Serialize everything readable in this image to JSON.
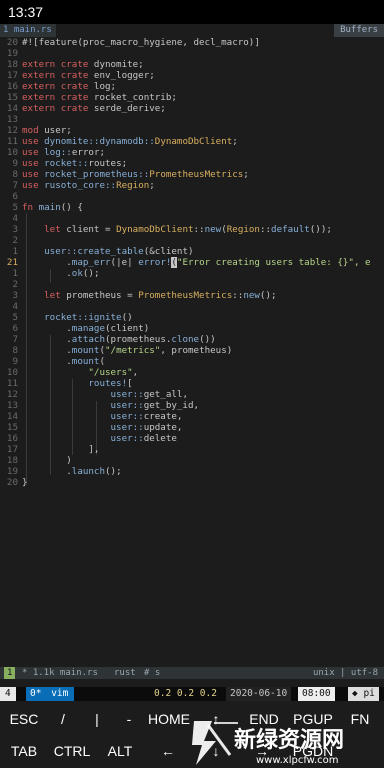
{
  "android_status": {
    "time": "13:37"
  },
  "tabline": {
    "active_tab": "1 main.rs",
    "buffers_label": "Buffers"
  },
  "editor": {
    "lines": [
      {
        "num": "20",
        "tokens": [
          {
            "t": "#![feature(proc_macro_hygiene, decl_macro)]",
            "c": "pl"
          }
        ]
      },
      {
        "num": "19",
        "tokens": []
      },
      {
        "num": "18",
        "tokens": [
          {
            "t": "extern crate",
            "c": "kw"
          },
          {
            "t": " dynomite;",
            "c": "pl"
          }
        ]
      },
      {
        "num": "17",
        "tokens": [
          {
            "t": "extern crate",
            "c": "kw"
          },
          {
            "t": " env_logger;",
            "c": "pl"
          }
        ]
      },
      {
        "num": "16",
        "tokens": [
          {
            "t": "extern crate",
            "c": "kw"
          },
          {
            "t": " log;",
            "c": "pl"
          }
        ]
      },
      {
        "num": "15",
        "tokens": [
          {
            "t": "extern crate",
            "c": "kw"
          },
          {
            "t": " rocket_contrib;",
            "c": "pl"
          }
        ]
      },
      {
        "num": "14",
        "tokens": [
          {
            "t": "extern crate",
            "c": "kw"
          },
          {
            "t": " serde_derive;",
            "c": "pl"
          }
        ]
      },
      {
        "num": "13",
        "tokens": []
      },
      {
        "num": "12",
        "tokens": [
          {
            "t": "mod",
            "c": "kw"
          },
          {
            "t": " user;",
            "c": "pl"
          }
        ]
      },
      {
        "num": "11",
        "tokens": [
          {
            "t": "use",
            "c": "kw"
          },
          {
            "t": " dynomite::dynamodb::",
            "c": "fn"
          },
          {
            "t": "DynamoDbClient",
            "c": "ty"
          },
          {
            "t": ";",
            "c": "pl"
          }
        ]
      },
      {
        "num": "10",
        "tokens": [
          {
            "t": "use",
            "c": "kw"
          },
          {
            "t": " log::",
            "c": "fn"
          },
          {
            "t": "error;",
            "c": "pl"
          }
        ]
      },
      {
        "num": "9",
        "tokens": [
          {
            "t": "use",
            "c": "kw"
          },
          {
            "t": " rocket::",
            "c": "fn"
          },
          {
            "t": "routes;",
            "c": "pl"
          }
        ]
      },
      {
        "num": "8",
        "tokens": [
          {
            "t": "use",
            "c": "kw"
          },
          {
            "t": " rocket_prometheus::",
            "c": "fn"
          },
          {
            "t": "PrometheusMetrics",
            "c": "ty"
          },
          {
            "t": ";",
            "c": "pl"
          }
        ]
      },
      {
        "num": "7",
        "tokens": [
          {
            "t": "use",
            "c": "kw"
          },
          {
            "t": " rusoto_core::",
            "c": "fn"
          },
          {
            "t": "Region",
            "c": "ty"
          },
          {
            "t": ";",
            "c": "pl"
          }
        ]
      },
      {
        "num": "6",
        "tokens": []
      },
      {
        "num": "5",
        "tokens": [
          {
            "t": "fn",
            "c": "kw"
          },
          {
            "t": " main",
            "c": "fn"
          },
          {
            "t": "() {",
            "c": "pl"
          }
        ]
      },
      {
        "num": "4",
        "tokens": []
      },
      {
        "num": "3",
        "tokens": [
          {
            "t": "    let",
            "c": "kw"
          },
          {
            "t": " client = ",
            "c": "pl"
          },
          {
            "t": "DynamoDbClient",
            "c": "ty"
          },
          {
            "t": "::",
            "c": "pl"
          },
          {
            "t": "new",
            "c": "fn"
          },
          {
            "t": "(",
            "c": "pl"
          },
          {
            "t": "Region",
            "c": "ty"
          },
          {
            "t": "::",
            "c": "pl"
          },
          {
            "t": "default",
            "c": "fn"
          },
          {
            "t": "());",
            "c": "pl"
          }
        ]
      },
      {
        "num": "2",
        "tokens": []
      },
      {
        "num": "1",
        "tokens": [
          {
            "t": "    user::",
            "c": "fn"
          },
          {
            "t": "create_table",
            "c": "fn"
          },
          {
            "t": "(&client)",
            "c": "pl"
          }
        ]
      },
      {
        "num": "21",
        "current": true,
        "tokens": [
          {
            "t": "        .",
            "c": "pl"
          },
          {
            "t": "map_err",
            "c": "fn"
          },
          {
            "t": "(|e| ",
            "c": "pl"
          },
          {
            "t": "error!",
            "c": "mac"
          },
          {
            "t": "(",
            "c": "cursor"
          },
          {
            "t": "\"Error creating users table: {}\", e",
            "c": "st"
          }
        ]
      },
      {
        "num": "1",
        "tokens": [
          {
            "t": "        .",
            "c": "pl"
          },
          {
            "t": "ok",
            "c": "fn"
          },
          {
            "t": "();",
            "c": "pl"
          }
        ]
      },
      {
        "num": "2",
        "tokens": []
      },
      {
        "num": "3",
        "tokens": [
          {
            "t": "    let",
            "c": "kw"
          },
          {
            "t": " prometheus = ",
            "c": "pl"
          },
          {
            "t": "PrometheusMetrics",
            "c": "ty"
          },
          {
            "t": "::",
            "c": "pl"
          },
          {
            "t": "new",
            "c": "fn"
          },
          {
            "t": "();",
            "c": "pl"
          }
        ]
      },
      {
        "num": "4",
        "tokens": []
      },
      {
        "num": "5",
        "tokens": [
          {
            "t": "    rocket::",
            "c": "fn"
          },
          {
            "t": "ignite",
            "c": "fn"
          },
          {
            "t": "()",
            "c": "pl"
          }
        ]
      },
      {
        "num": "6",
        "tokens": [
          {
            "t": "        .",
            "c": "pl"
          },
          {
            "t": "manage",
            "c": "fn"
          },
          {
            "t": "(client)",
            "c": "pl"
          }
        ]
      },
      {
        "num": "7",
        "tokens": [
          {
            "t": "        .",
            "c": "pl"
          },
          {
            "t": "attach",
            "c": "fn"
          },
          {
            "t": "(prometheus.",
            "c": "pl"
          },
          {
            "t": "clone",
            "c": "fn"
          },
          {
            "t": "())",
            "c": "pl"
          }
        ]
      },
      {
        "num": "8",
        "tokens": [
          {
            "t": "        .",
            "c": "pl"
          },
          {
            "t": "mount",
            "c": "fn"
          },
          {
            "t": "(",
            "c": "pl"
          },
          {
            "t": "\"/metrics\"",
            "c": "st"
          },
          {
            "t": ", prometheus)",
            "c": "pl"
          }
        ]
      },
      {
        "num": "9",
        "tokens": [
          {
            "t": "        .",
            "c": "pl"
          },
          {
            "t": "mount",
            "c": "fn"
          },
          {
            "t": "(",
            "c": "pl"
          }
        ]
      },
      {
        "num": "10",
        "tokens": [
          {
            "t": "            \"/users\"",
            "c": "st"
          },
          {
            "t": ",",
            "c": "pl"
          }
        ]
      },
      {
        "num": "11",
        "tokens": [
          {
            "t": "            routes!",
            "c": "mac"
          },
          {
            "t": "[",
            "c": "pl"
          }
        ]
      },
      {
        "num": "12",
        "tokens": [
          {
            "t": "                user::",
            "c": "fn"
          },
          {
            "t": "get_all",
            "c": "pl"
          },
          {
            "t": ",",
            "c": "pl"
          }
        ]
      },
      {
        "num": "13",
        "tokens": [
          {
            "t": "                user::",
            "c": "fn"
          },
          {
            "t": "get_by_id",
            "c": "pl"
          },
          {
            "t": ",",
            "c": "pl"
          }
        ]
      },
      {
        "num": "14",
        "tokens": [
          {
            "t": "                user::",
            "c": "fn"
          },
          {
            "t": "create",
            "c": "pl"
          },
          {
            "t": ",",
            "c": "pl"
          }
        ]
      },
      {
        "num": "15",
        "tokens": [
          {
            "t": "                user::",
            "c": "fn"
          },
          {
            "t": "update",
            "c": "pl"
          },
          {
            "t": ",",
            "c": "pl"
          }
        ]
      },
      {
        "num": "16",
        "tokens": [
          {
            "t": "                user::",
            "c": "fn"
          },
          {
            "t": "delete",
            "c": "pl"
          }
        ]
      },
      {
        "num": "17",
        "tokens": [
          {
            "t": "            ],",
            "c": "pl"
          }
        ]
      },
      {
        "num": "18",
        "tokens": [
          {
            "t": "        )",
            "c": "pl"
          }
        ]
      },
      {
        "num": "19",
        "tokens": [
          {
            "t": "        .",
            "c": "pl"
          },
          {
            "t": "launch",
            "c": "fn"
          },
          {
            "t": "();",
            "c": "pl"
          }
        ]
      },
      {
        "num": "20",
        "tokens": [
          {
            "t": "}",
            "c": "pl"
          }
        ]
      }
    ]
  },
  "vim_status": {
    "mode_num": "1",
    "file_info": "* 1.1k main.rs",
    "filetype": "rust",
    "section": "# s",
    "encoding": "unix | utf-8"
  },
  "tmux": {
    "session": "4",
    "window_index": "0*",
    "window_name": "vim",
    "load": "0.2 0.2 0.2",
    "date": "2020-06-10",
    "time": "08:00",
    "host": "pi"
  },
  "extra_keys": {
    "row1": [
      "ESC",
      "/",
      "|",
      "-",
      "HOME",
      "↑",
      "END",
      "PGUP",
      "FN"
    ],
    "row2": [
      "TAB",
      "CTRL",
      "ALT",
      "←",
      "↓",
      "→",
      "PGDN"
    ]
  },
  "watermark": {
    "text": "新绿资源网",
    "url": "www.xlpcfw.com"
  }
}
